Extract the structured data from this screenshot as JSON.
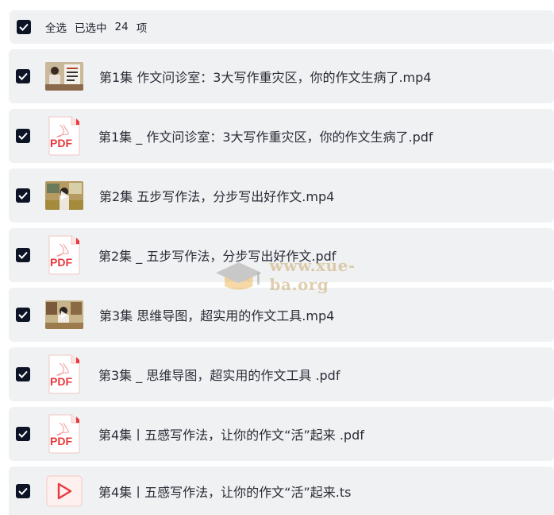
{
  "header": {
    "select_all": "全选",
    "selected_label": "已选中",
    "count": "24",
    "unit": "项"
  },
  "files": [
    {
      "name": "第1集  作文问诊室：3大写作重灾区，你的作文生病了.mp4",
      "type": "video",
      "checked": true
    },
    {
      "name": "第1集 _ 作文问诊室：3大写作重灾区，你的作文生病了.pdf",
      "type": "pdf",
      "checked": true
    },
    {
      "name": "第2集  五步写作法，分步写出好作文.mp4",
      "type": "video",
      "checked": true
    },
    {
      "name": "第2集 _ 五步写作法，分步写出好作文.pdf",
      "type": "pdf",
      "checked": true
    },
    {
      "name": "第3集  思维导图，超实用的作文工具.mp4",
      "type": "video",
      "checked": true
    },
    {
      "name": "第3集 _ 思维导图，超实用的作文工具 .pdf",
      "type": "pdf",
      "checked": true
    },
    {
      "name": "第4集丨五感写作法，让你的作文“活”起来 .pdf",
      "type": "pdf",
      "checked": true
    },
    {
      "name": "第4集丨五感写作法，让你的作文“活”起来.ts",
      "type": "ts",
      "checked": true
    }
  ],
  "pdf_badge": "PDF",
  "watermark": "www.xue-ba.org",
  "colors": {
    "checkbox": "#0d1426",
    "row_bg": "#f0f1f3",
    "pdf_red": "#e8383d"
  }
}
